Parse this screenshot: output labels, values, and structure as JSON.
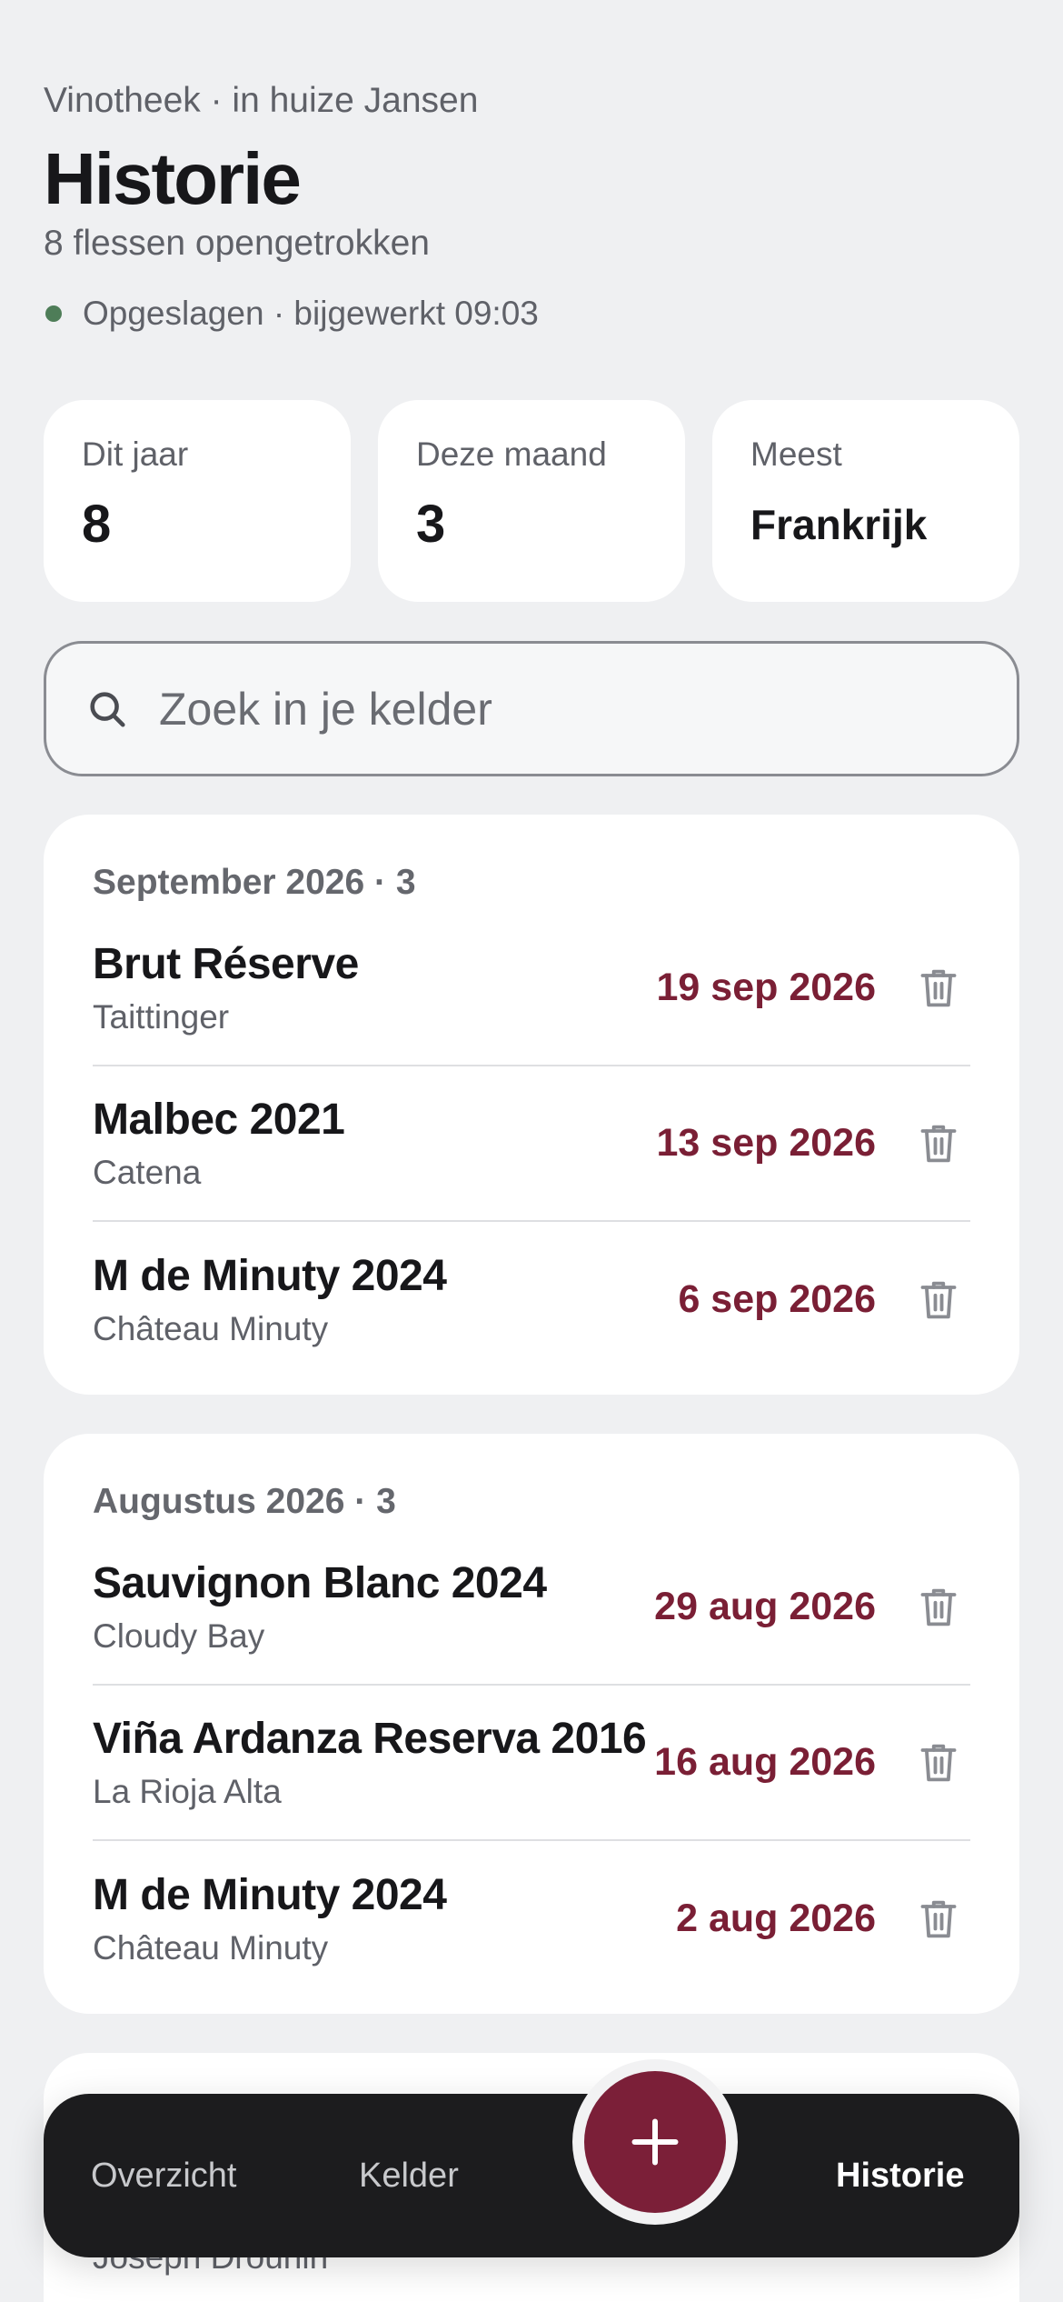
{
  "header": {
    "eyebrow": "Vinotheek · in huize Jansen",
    "title": "Historie",
    "subtitle": "8 flessen opengetrokken",
    "status": "Opgeslagen · bijgewerkt 09:03"
  },
  "stats": [
    {
      "label": "Dit jaar",
      "value": "8"
    },
    {
      "label": "Deze maand",
      "value": "3"
    },
    {
      "label": "Meest",
      "value": "Frankrijk"
    }
  ],
  "search": {
    "placeholder": "Zoek in je kelder"
  },
  "groups": [
    {
      "month": "September 2026 · 3",
      "items": [
        {
          "name": "Brut Réserve",
          "producer": "Taittinger",
          "date": "19 sep 2026"
        },
        {
          "name": "Malbec 2021",
          "producer": "Catena",
          "date": "13 sep 2026"
        },
        {
          "name": "M de Minuty 2024",
          "producer": "Château Minuty",
          "date": "6 sep 2026"
        }
      ]
    },
    {
      "month": "Augustus 2026 · 3",
      "items": [
        {
          "name": "Sauvignon Blanc 2024",
          "producer": "Cloudy Bay",
          "date": "29 aug 2026"
        },
        {
          "name": "Viña Ardanza Reserva 2016",
          "producer": "La Rioja Alta",
          "date": "16 aug 2026"
        },
        {
          "name": "M de Minuty 2024",
          "producer": "Château Minuty",
          "date": "2 aug 2026"
        }
      ]
    }
  ],
  "peek_producer": "Joseph Drouhin",
  "nav": {
    "overview": "Overzicht",
    "cellar": "Kelder",
    "history": "Historie"
  },
  "colors": {
    "accent": "#7b1f38",
    "date": "#7a1f35",
    "status_dot": "#4e7d58",
    "background": "#eff0f2",
    "navbar": "#1c1c1e"
  }
}
